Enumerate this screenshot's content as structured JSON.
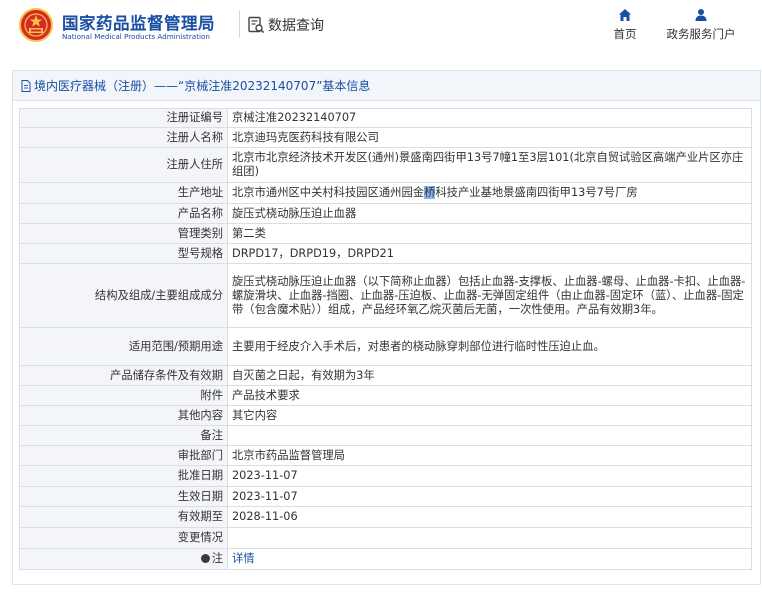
{
  "header": {
    "brand_cn": "国家药品监督管理局",
    "brand_en": "National Medical Products Administration",
    "query_label": "数据查询",
    "nav": [
      {
        "label": "首页",
        "icon": "home-icon"
      },
      {
        "label": "政务服务门户",
        "icon": "user-icon"
      }
    ],
    "colors": {
      "brand": "#1a4fa3",
      "emblem_red": "#d7282a",
      "emblem_gold": "#f3c342"
    }
  },
  "panel": {
    "title": "境内医疗器械（注册）——“京械注准20232140707”基本信息"
  },
  "rows": [
    {
      "label": "注册证编号",
      "value": "京械注准20232140707"
    },
    {
      "label": "注册人名称",
      "value": "北京迪玛克医药科技有限公司"
    },
    {
      "label": "注册人住所",
      "value": "北京市北京经济技术开发区(通州)景盛南四街甲13号7幢1至3层101(北京自贸试验区高端产业片区亦庄组团)"
    },
    {
      "label": "生产地址",
      "value_before": "北京市通州区中关村科技园区通州园金",
      "value_highlight": "桥",
      "value_after": "科技产业基地景盛南四街甲13号7号厂房"
    },
    {
      "label": "产品名称",
      "value": "旋压式桡动脉压迫止血器"
    },
    {
      "label": "管理类别",
      "value": "第二类"
    },
    {
      "label": "型号规格",
      "value": "DRPD17，DRPD19，DRPD21"
    },
    {
      "label": "结构及组成/主要组成成分",
      "value": "旋压式桡动脉压迫止血器（以下简称止血器）包括止血器-支撑板、止血器-螺母、止血器-卡扣、止血器-螺旋滑块、止血器-挡圈、止血器-压迫板、止血器-无弹固定组件（由止血器-固定环（蓝）、止血器-固定带（包含魔术贴））组成，产品经环氧乙烷灭菌后无菌，一次性使用。产品有效期3年。"
    },
    {
      "label": "适用范围/预期用途",
      "value": "主要用于经皮介入手术后，对患者的桡动脉穿刺部位进行临时性压迫止血。"
    },
    {
      "label": "产品储存条件及有效期",
      "value": "自灭菌之日起，有效期为3年"
    },
    {
      "label": "附件",
      "value": "产品技术要求"
    },
    {
      "label": "其他内容",
      "value": "其它内容"
    },
    {
      "label": "备注",
      "value": ""
    },
    {
      "label": "审批部门",
      "value": "北京市药品监督管理局"
    },
    {
      "label": "批准日期",
      "value": "2023-11-07"
    },
    {
      "label": "生效日期",
      "value": "2023-11-07"
    },
    {
      "label": "有效期至",
      "value": "2028-11-06"
    },
    {
      "label": "变更情况",
      "value": ""
    },
    {
      "label": "注",
      "value": "详情"
    }
  ]
}
